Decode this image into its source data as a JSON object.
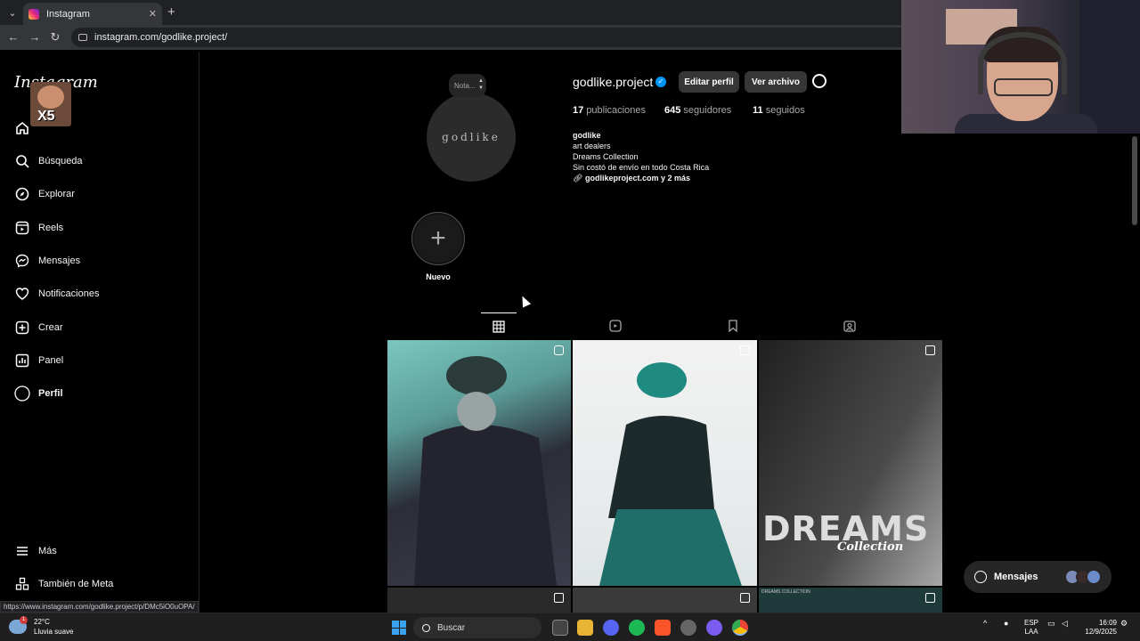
{
  "browser": {
    "tab_title": "Instagram",
    "url": "instagram.com/godlike.project/",
    "status_url": "https://www.instagram.com/godlike.project/p/DMc5iO0uOPA/"
  },
  "sidebar": {
    "logo": "Instagram",
    "overlay_text": "X5",
    "items": [
      {
        "label": "Inicio",
        "icon": "home-icon"
      },
      {
        "label": "Búsqueda",
        "icon": "search-icon"
      },
      {
        "label": "Explorar",
        "icon": "compass-icon"
      },
      {
        "label": "Reels",
        "icon": "reels-icon"
      },
      {
        "label": "Mensajes",
        "icon": "messenger-icon"
      },
      {
        "label": "Notificaciones",
        "icon": "heart-icon"
      },
      {
        "label": "Crear",
        "icon": "plus-square-icon"
      },
      {
        "label": "Panel",
        "icon": "chart-icon"
      },
      {
        "label": "Perfil",
        "icon": "profile-avatar"
      }
    ],
    "more": {
      "label": "Más",
      "icon": "menu-icon"
    },
    "meta": {
      "label": "También de Meta",
      "icon": "meta-apps-icon"
    }
  },
  "profile": {
    "note_placeholder": "Nota...",
    "avatar_text": "godlike",
    "username": "godlike.project",
    "edit_button": "Editar perfil",
    "archive_button": "Ver archivo",
    "stats": {
      "posts_count": "17",
      "posts_label": "publicaciones",
      "followers_count": "645",
      "followers_label": "seguidores",
      "following_count": "11",
      "following_label": "seguidos"
    },
    "bio": {
      "name": "godlike",
      "line1": "art dealers",
      "line2": "Dreams Collection",
      "line3": "Sin costó de envío en todo Costa Rica",
      "link": "godlikeproject.com y 2 más"
    },
    "highlight_label": "Nuevo"
  },
  "grid": {
    "posts": [
      {
        "type": "reel"
      },
      {
        "type": "carousel"
      },
      {
        "type": "carousel",
        "title": "DREAMS",
        "subtitle": "Collection"
      }
    ],
    "row2_caption": "DREAMS COLLECTION"
  },
  "messages_pill": {
    "label": "Mensajes"
  },
  "taskbar": {
    "temperature": "22°C",
    "weather": "Lluvia suave",
    "weather_badge": "1",
    "search": "Buscar",
    "lang1": "ESP",
    "lang2": "LAA",
    "time": "16:09",
    "date": "12/9/2025"
  },
  "colors": {
    "verified": "#0095f6",
    "background": "#000000",
    "button": "#363636"
  }
}
